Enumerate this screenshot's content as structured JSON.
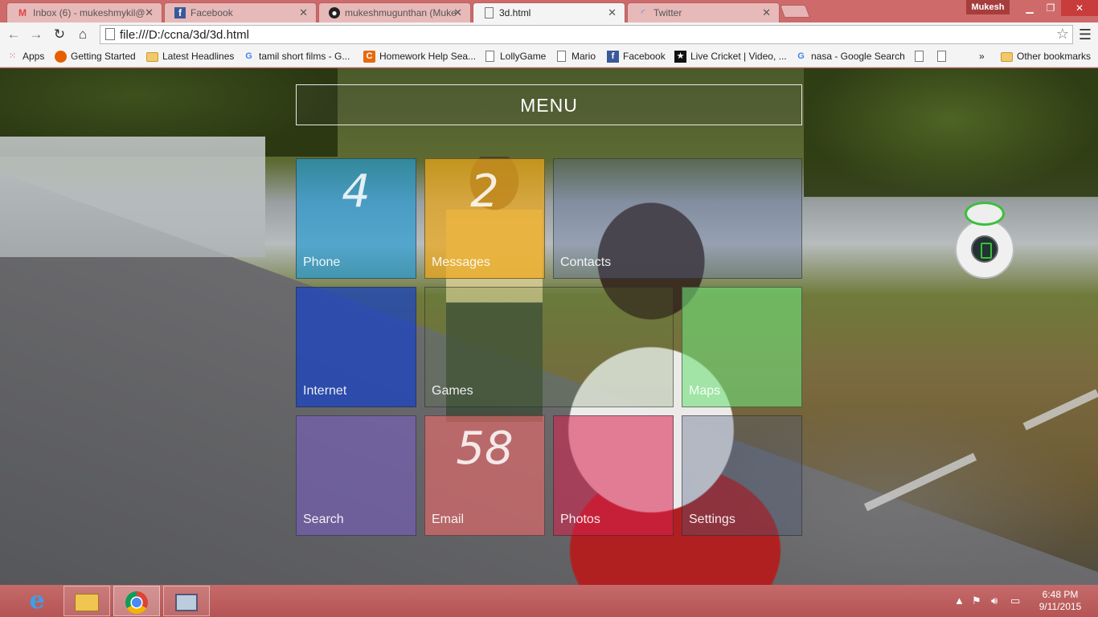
{
  "browser": {
    "tabs": [
      {
        "title": "Inbox (6) - mukeshmykil@",
        "icon": "gmail-icon",
        "active": false
      },
      {
        "title": "Facebook",
        "icon": "facebook-icon",
        "active": false
      },
      {
        "title": "mukeshmugunthan (Muke",
        "icon": "github-icon",
        "active": false
      },
      {
        "title": "3d.html",
        "icon": "page-icon",
        "active": true
      },
      {
        "title": "Twitter",
        "icon": "loading-icon",
        "active": false
      }
    ],
    "profile_name": "Mukesh",
    "url": "file:///D:/ccna/3d/3d.html",
    "bookmarks": [
      {
        "label": "Apps",
        "icon": "apps-icon"
      },
      {
        "label": "Getting Started",
        "icon": "firefox-icon"
      },
      {
        "label": "Latest Headlines",
        "icon": "folder-icon"
      },
      {
        "label": "tamil short films - G...",
        "icon": "google-icon"
      },
      {
        "label": "Homework Help Sea...",
        "icon": "chegg-icon"
      },
      {
        "label": "LollyGame",
        "icon": "page-icon"
      },
      {
        "label": "Mario",
        "icon": "page-icon"
      },
      {
        "label": "Facebook",
        "icon": "facebook-icon"
      },
      {
        "label": "Live Cricket | Video, ...",
        "icon": "star-icon"
      },
      {
        "label": "nasa - Google Search",
        "icon": "google-icon"
      },
      {
        "label": "",
        "icon": "page-icon"
      },
      {
        "label": "",
        "icon": "page-icon"
      }
    ],
    "bookmarks_overflow": "»",
    "other_bookmarks": "Other bookmarks"
  },
  "page": {
    "menu_title": "MENU",
    "tiles": [
      {
        "label": "Phone",
        "count": "4",
        "color": "#1e9ad6"
      },
      {
        "label": "Messages",
        "count": "2",
        "color": "#f0a818"
      },
      {
        "label": "Contacts",
        "count": "",
        "color": "#5a6e9e"
      },
      {
        "label": "Internet",
        "count": "",
        "color": "#1540c8"
      },
      {
        "label": "Games",
        "count": "",
        "color": "#5b7f3e"
      },
      {
        "label": "Maps",
        "count": "",
        "color": "#6fe07a"
      },
      {
        "label": "Search",
        "count": "",
        "color": "#7a5ec8"
      },
      {
        "label": "Email",
        "count": "58",
        "color": "#f06a6a"
      },
      {
        "label": "Photos",
        "count": "",
        "color": "#d8204c"
      },
      {
        "label": "Settings",
        "count": "",
        "color": "#4a5878"
      }
    ]
  },
  "taskbar": {
    "apps": [
      "internet-explorer-icon",
      "file-explorer-icon",
      "chrome-icon",
      "remote-desktop-icon"
    ],
    "time": "6:48 PM",
    "date": "9/11/2015"
  }
}
